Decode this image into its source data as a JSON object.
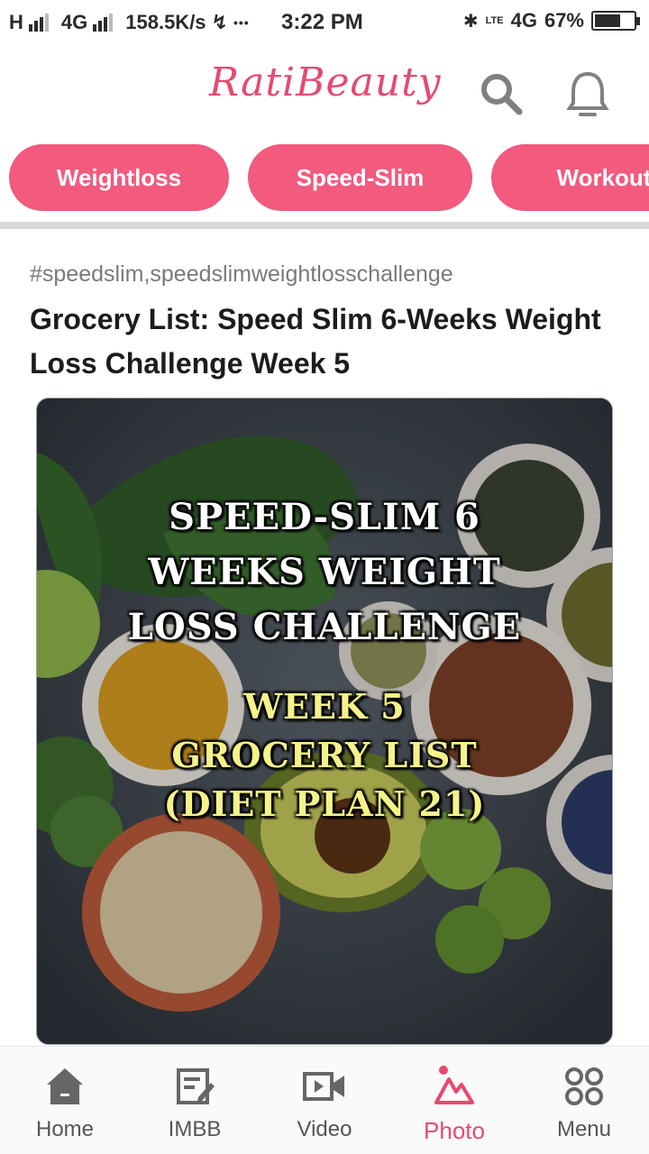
{
  "status_bar": {
    "network_left": "H",
    "network_mid": "4G",
    "speed": "158.5K/s",
    "usb": "↯",
    "dots": "•••",
    "time": "3:22 PM",
    "bluetooth": "✱",
    "volte": "LTE",
    "network_right": "4G",
    "battery": "67%",
    "battery_level": 0.67
  },
  "header": {
    "logo": "RatiBeauty",
    "search_icon": "search-icon",
    "bell_icon": "bell-icon"
  },
  "categories": [
    {
      "label": "Weightloss"
    },
    {
      "label": "Speed-Slim"
    },
    {
      "label": "Workout"
    }
  ],
  "article": {
    "tags": "#speedslim,speedslimweightlosschallenge",
    "title": "Grocery List: Speed Slim 6-Weeks Weight Loss Challenge Week 5",
    "image": {
      "line1": "SPEED-SLIM 6",
      "line2": "WEEKS WEIGHT",
      "line3": "LOSS CHALLENGE",
      "line4": "WEEK 5",
      "line5": "GROCERY LIST",
      "line6": "(DIET PLAN 21)"
    }
  },
  "bottom_nav": {
    "items": [
      {
        "label": "Home",
        "icon": "home-icon"
      },
      {
        "label": "IMBB",
        "icon": "edit-icon"
      },
      {
        "label": "Video",
        "icon": "video-icon"
      },
      {
        "label": "Photo",
        "icon": "photo-icon",
        "active": true
      },
      {
        "label": "Menu",
        "icon": "grid-icon"
      }
    ],
    "active_color": "#e64a6e"
  },
  "colors": {
    "brand": "#e64a6e",
    "pill": "#f25a7e"
  }
}
